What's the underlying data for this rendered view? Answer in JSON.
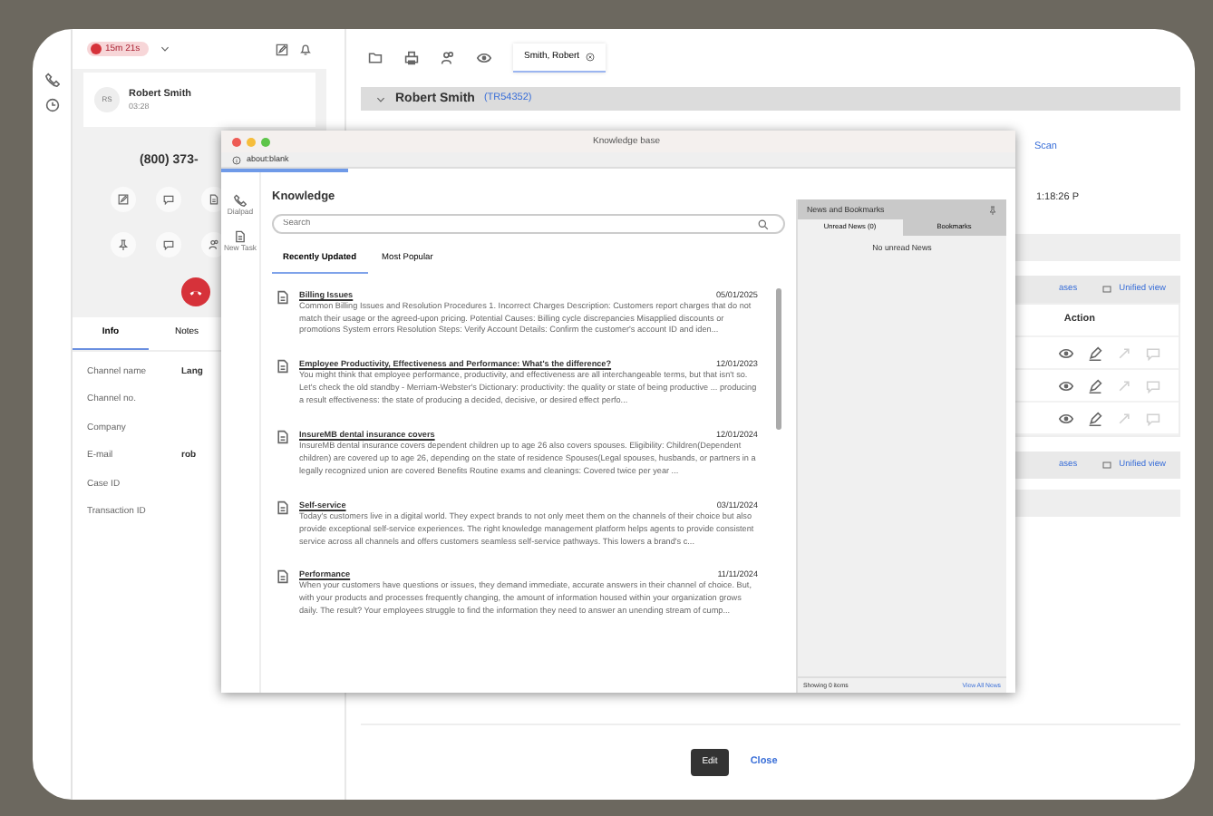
{
  "phone": {
    "timer": "15m 21s",
    "caller": {
      "name": "Robert Smith",
      "initials": "RS",
      "duration": "03:28"
    },
    "number": "(800) 373-",
    "tabs": [
      {
        "label": "Info",
        "selected": true
      },
      {
        "label": "Notes",
        "selected": false
      }
    ],
    "fields": [
      {
        "label": "Channel name",
        "value": "Lang"
      },
      {
        "label": "Channel no."
      },
      {
        "label": "Company"
      },
      {
        "label": "E-mail",
        "value": "rob"
      },
      {
        "label": "Case ID"
      },
      {
        "label": "Transaction ID"
      }
    ]
  },
  "app": {
    "tabs": [
      {
        "label": "Smith, Robert",
        "selected": true
      }
    ],
    "record": {
      "name": "Robert Smith",
      "id": "(TR54352)"
    },
    "scan_link": "Scan",
    "time": "1:18:26 P",
    "link_bars": [
      {
        "left": "ases",
        "right": "Unified view"
      },
      {
        "left": "ases",
        "right": "Unified view"
      }
    ],
    "action_header": "Action",
    "action_rows": [
      {
        "actions": [
          {
            "kind": "view",
            "disabled": false
          },
          {
            "kind": "edit",
            "disabled": false
          },
          {
            "kind": "link",
            "disabled": true
          },
          {
            "kind": "message",
            "disabled": true
          }
        ]
      },
      {
        "actions": [
          {
            "kind": "view",
            "disabled": false
          },
          {
            "kind": "edit",
            "disabled": false
          },
          {
            "kind": "link",
            "disabled": true
          },
          {
            "kind": "message",
            "disabled": true
          }
        ]
      },
      {
        "actions": [
          {
            "kind": "view",
            "disabled": false
          },
          {
            "kind": "edit",
            "disabled": false
          },
          {
            "kind": "link",
            "disabled": true
          },
          {
            "kind": "message",
            "disabled": true
          }
        ]
      }
    ],
    "buttons": {
      "edit": "Edit",
      "close": "Close"
    }
  },
  "knowledge_window": {
    "title": "Knowledge base",
    "address": "about:blank",
    "progress": {
      "level": 0.16
    },
    "rail": [
      {
        "kind": "phone",
        "label": "Dialpad"
      },
      {
        "kind": "note",
        "label": "New Task"
      }
    ],
    "heading": "Knowledge",
    "search": {
      "placeholder": "Search"
    },
    "tabs": [
      {
        "label": "Recently Updated",
        "selected": true
      },
      {
        "label": "Most Popular",
        "selected": false
      }
    ],
    "articles": [
      {
        "title": "Billing Issues",
        "date": "05/01/2025",
        "text": "Common Billing Issues and Resolution Procedures 1. Incorrect Charges Description: Customers report charges that do not match their usage or the agreed-upon pricing. Potential Causes: Billing cycle discrepancies Misapplied discounts or promotions System errors Resolution Steps: Verify Account Details: Confirm the customer's account ID and iden..."
      },
      {
        "title": "Employee Productivity, Effectiveness and Performance: What's the difference?",
        "date": "12/01/2023",
        "text": "You might think that employee performance, productivity, and effectiveness are all interchangeable terms, but that isn't so. Let's check the old standby - Merriam-Webster's Dictionary: productivity: the quality or state of being productive ... producing a result effectiveness: the state of producing a decided, decisive, or desired effect perfo..."
      },
      {
        "title": "InsureMB dental insurance covers",
        "date": "12/01/2024",
        "text": "InsureMB dental insurance covers dependent children up to age 26 also covers spouses. Eligibility: Children(Dependent children) are covered up to age 26, depending on the state of residence Spouses(Legal spouses, husbands, or partners in a legally recognized union are covered Benefits Routine exams and cleanings: Covered twice per year ..."
      },
      {
        "title": "Self-service",
        "date": "03/11/2024",
        "text": "Today's customers live in a digital world. They expect brands to not only meet them on the channels of their choice but also provide exceptional self-service experiences. The right knowledge management platform helps agents to provide consistent service across all channels and offers customers seamless self-service pathways. This lowers a brand's c..."
      },
      {
        "title": "Performance",
        "date": "11/11/2024",
        "text": "When your customers have questions or issues, they demand immediate, accurate answers in their channel of choice. But, with your products and processes frequently changing, the amount of information housed within your organization grows daily. The result? Your employees struggle to find the information they need to answer an unending stream of cump..."
      }
    ],
    "news": {
      "title": "News and Bookmarks",
      "tabs": [
        {
          "label": "Unread News (0)",
          "selected": true
        },
        {
          "label": "Bookmarks",
          "selected": false
        }
      ],
      "empty": "No unread News",
      "count": "Showing 0 items",
      "view_all": "View All News"
    }
  }
}
